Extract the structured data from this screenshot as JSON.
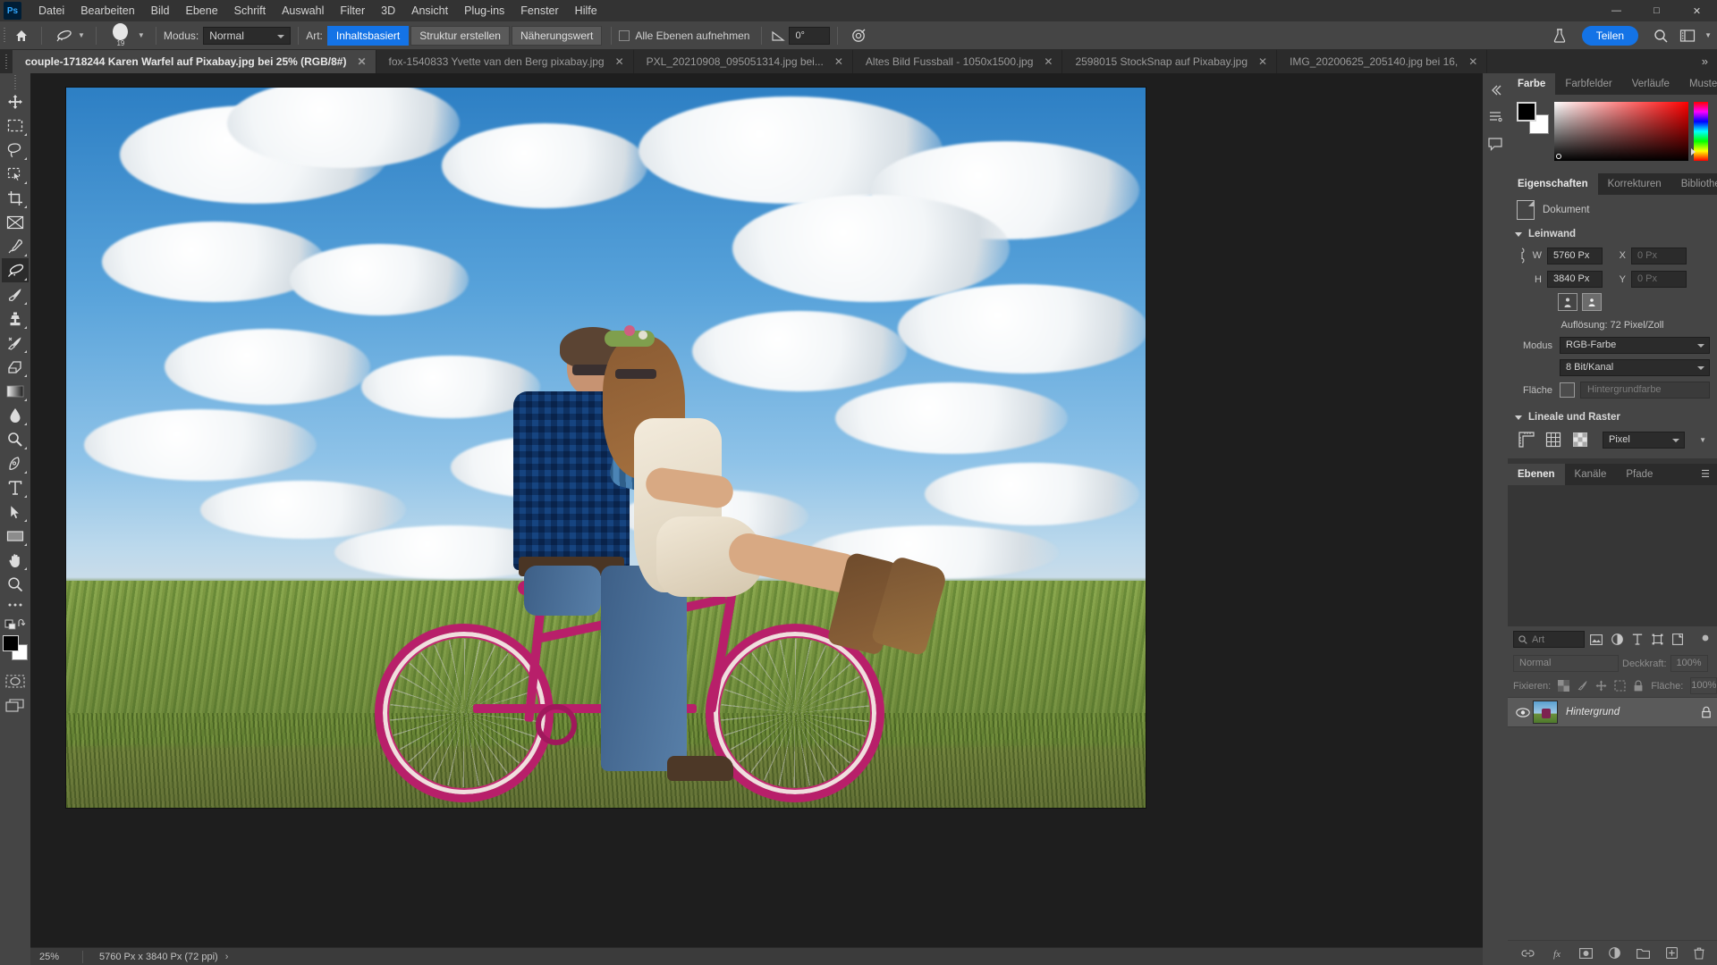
{
  "app": {
    "logo": "Ps",
    "menus": [
      "Datei",
      "Bearbeiten",
      "Bild",
      "Ebene",
      "Schrift",
      "Auswahl",
      "Filter",
      "3D",
      "Ansicht",
      "Plug-ins",
      "Fenster",
      "Hilfe"
    ],
    "window_controls": {
      "minimize": "—",
      "maximize": "□",
      "close": "✕"
    }
  },
  "options_bar": {
    "home_icon": "home-icon",
    "tool_preset_icon": "healing-brush-icon",
    "brush_size": "19",
    "mode_label": "Modus:",
    "mode_value": "Normal",
    "type_label": "Art:",
    "type_options": [
      "Inhaltsbasiert",
      "Struktur erstellen",
      "Näherungswert"
    ],
    "type_selected": "Inhaltsbasiert",
    "sample_all_layers": "Alle Ebenen aufnehmen",
    "angle_value": "0°",
    "pressure_icon": "pressure-icon",
    "flask_icon": "flask-icon",
    "share_label": "Teilen",
    "search_icon": "search-icon",
    "workspace_icon": "workspace-icon"
  },
  "tabs": [
    {
      "label": "couple-1718244 Karen Warfel auf Pixabay.jpg bei 25% (RGB/8#)",
      "active": true,
      "close": "✕"
    },
    {
      "label": "fox-1540833 Yvette van den Berg pixabay.jpg",
      "active": false,
      "close": "✕"
    },
    {
      "label": "PXL_20210908_095051314.jpg bei...",
      "active": false,
      "close": "✕"
    },
    {
      "label": "Altes Bild Fussball - 1050x1500.jpg",
      "active": false,
      "close": "✕"
    },
    {
      "label": "2598015 StockSnap auf Pixabay.jpg",
      "active": false,
      "close": "✕"
    },
    {
      "label": "IMG_20200625_205140.jpg bei 16,",
      "active": false,
      "close": "✕"
    }
  ],
  "tab_overflow": "»",
  "toolbar": {
    "tools": [
      {
        "name": "move-tool",
        "icon": "move-icon",
        "selected": false,
        "corner": false
      },
      {
        "name": "rectangular-marquee-tool",
        "icon": "marquee-icon",
        "selected": false,
        "corner": true
      },
      {
        "name": "lasso-tool",
        "icon": "lasso-icon",
        "selected": false,
        "corner": true
      },
      {
        "name": "object-selection-tool",
        "icon": "object-select-icon",
        "selected": false,
        "corner": true
      },
      {
        "name": "crop-tool",
        "icon": "crop-icon",
        "selected": false,
        "corner": true
      },
      {
        "name": "frame-tool",
        "icon": "frame-icon",
        "selected": false,
        "corner": false
      },
      {
        "name": "eyedropper-tool",
        "icon": "eyedropper-icon",
        "selected": false,
        "corner": true
      },
      {
        "name": "healing-brush-tool",
        "icon": "healing-brush-icon",
        "selected": true,
        "corner": true
      },
      {
        "name": "brush-tool",
        "icon": "brush-icon",
        "selected": false,
        "corner": true
      },
      {
        "name": "clone-stamp-tool",
        "icon": "clone-stamp-icon",
        "selected": false,
        "corner": true
      },
      {
        "name": "history-brush-tool",
        "icon": "history-brush-icon",
        "selected": false,
        "corner": true
      },
      {
        "name": "eraser-tool",
        "icon": "eraser-icon",
        "selected": false,
        "corner": true
      },
      {
        "name": "gradient-tool",
        "icon": "gradient-icon",
        "selected": false,
        "corner": true
      },
      {
        "name": "blur-tool",
        "icon": "blur-drop-icon",
        "selected": false,
        "corner": true
      },
      {
        "name": "dodge-tool",
        "icon": "dodge-icon",
        "selected": false,
        "corner": true
      },
      {
        "name": "pen-tool",
        "icon": "pen-icon",
        "selected": false,
        "corner": true
      },
      {
        "name": "type-tool",
        "icon": "type-icon",
        "selected": false,
        "corner": true
      },
      {
        "name": "path-selection-tool",
        "icon": "path-select-icon",
        "selected": false,
        "corner": true
      },
      {
        "name": "rectangle-tool",
        "icon": "rectangle-icon",
        "selected": false,
        "corner": true
      },
      {
        "name": "hand-tool",
        "icon": "hand-icon",
        "selected": false,
        "corner": true
      },
      {
        "name": "zoom-tool",
        "icon": "zoom-icon",
        "selected": false,
        "corner": false
      },
      {
        "name": "edit-toolbar-button",
        "icon": "ellipsis-icon",
        "selected": false,
        "corner": false
      },
      {
        "name": "default-colors-button",
        "icon": "default-colors-icon",
        "selected": false,
        "corner": false
      }
    ],
    "quickmask": "quick-mask-icon",
    "screenmode": "screen-mode-icon"
  },
  "panels": {
    "color": {
      "tabs": [
        "Farbe",
        "Farbfelder",
        "Verläufe",
        "Muster"
      ],
      "active": "Farbe",
      "menu_icon": "panel-menu-icon",
      "foreground": "#000000",
      "background": "#ffffff"
    },
    "properties": {
      "tabs": [
        "Eigenschaften",
        "Korrekturen",
        "Bibliotheken"
      ],
      "active": "Eigenschaften",
      "menu_icon": "panel-menu-icon",
      "doc_label": "Dokument",
      "canvas_section": "Leinwand",
      "w_label": "W",
      "w_value": "5760 Px",
      "h_label": "H",
      "h_value": "3840 Px",
      "x_label": "X",
      "x_value": "0 Px",
      "y_label": "Y",
      "y_value": "0 Px",
      "resolution": "Auflösung: 72 Pixel/Zoll",
      "mode_label": "Modus",
      "mode_value": "RGB-Farbe",
      "depth_value": "8 Bit/Kanal",
      "fill_label": "Fläche",
      "fill_value": "Hintergrundfarbe",
      "rulers_section": "Lineale und Raster",
      "units_value": "Pixel",
      "ruler_icon": "ruler-icon",
      "grid_icon": "grid-icon",
      "transparency_icon": "transparency-grid-icon"
    },
    "layers": {
      "tabs": [
        "Ebenen",
        "Kanäle",
        "Pfade"
      ],
      "active": "Ebenen",
      "menu_icon": "panel-menu-icon",
      "filter_placeholder": "Art",
      "filter_icons": [
        "pixel-filter-icon",
        "adjustment-filter-icon",
        "type-filter-icon",
        "shape-filter-icon",
        "smart-object-filter-icon"
      ],
      "toggle_icon": "filter-toggle-icon",
      "blend_mode": "Normal",
      "opacity_label": "Deckkraft:",
      "opacity_value": "100%",
      "lock_label": "Fixieren:",
      "lock_icons": [
        "lock-transparency-icon",
        "lock-image-icon",
        "lock-position-icon",
        "lock-artboard-icon",
        "lock-all-icon"
      ],
      "fill_label": "Fläche:",
      "fill_value": "100%",
      "rows": [
        {
          "name": "Hintergrund",
          "visible": true,
          "locked": true,
          "eye_icon": "eye-icon",
          "lock_icon": "lock-icon"
        }
      ],
      "footer_icons": [
        "link-layers-icon",
        "layer-styles-icon",
        "layer-mask-icon",
        "adjustment-layer-icon",
        "new-group-icon",
        "new-layer-icon",
        "delete-layer-icon"
      ]
    },
    "rail": [
      "history-rail-icon",
      "comments-rail-icon"
    ]
  },
  "status_bar": {
    "zoom": "25%",
    "doc_info": "5760 Px x 3840 Px (72 ppi)",
    "arrow": "›"
  },
  "canvas": {
    "alt": "Couple on a pink bicycle in a green meadow under a blue cloudy sky"
  },
  "colors": {
    "accent": "#1473e6",
    "menubar_bg": "#333333",
    "panel_bg": "#454545",
    "dark_bg": "#2b2b2b",
    "canvas_bg": "#1e1e1e"
  }
}
